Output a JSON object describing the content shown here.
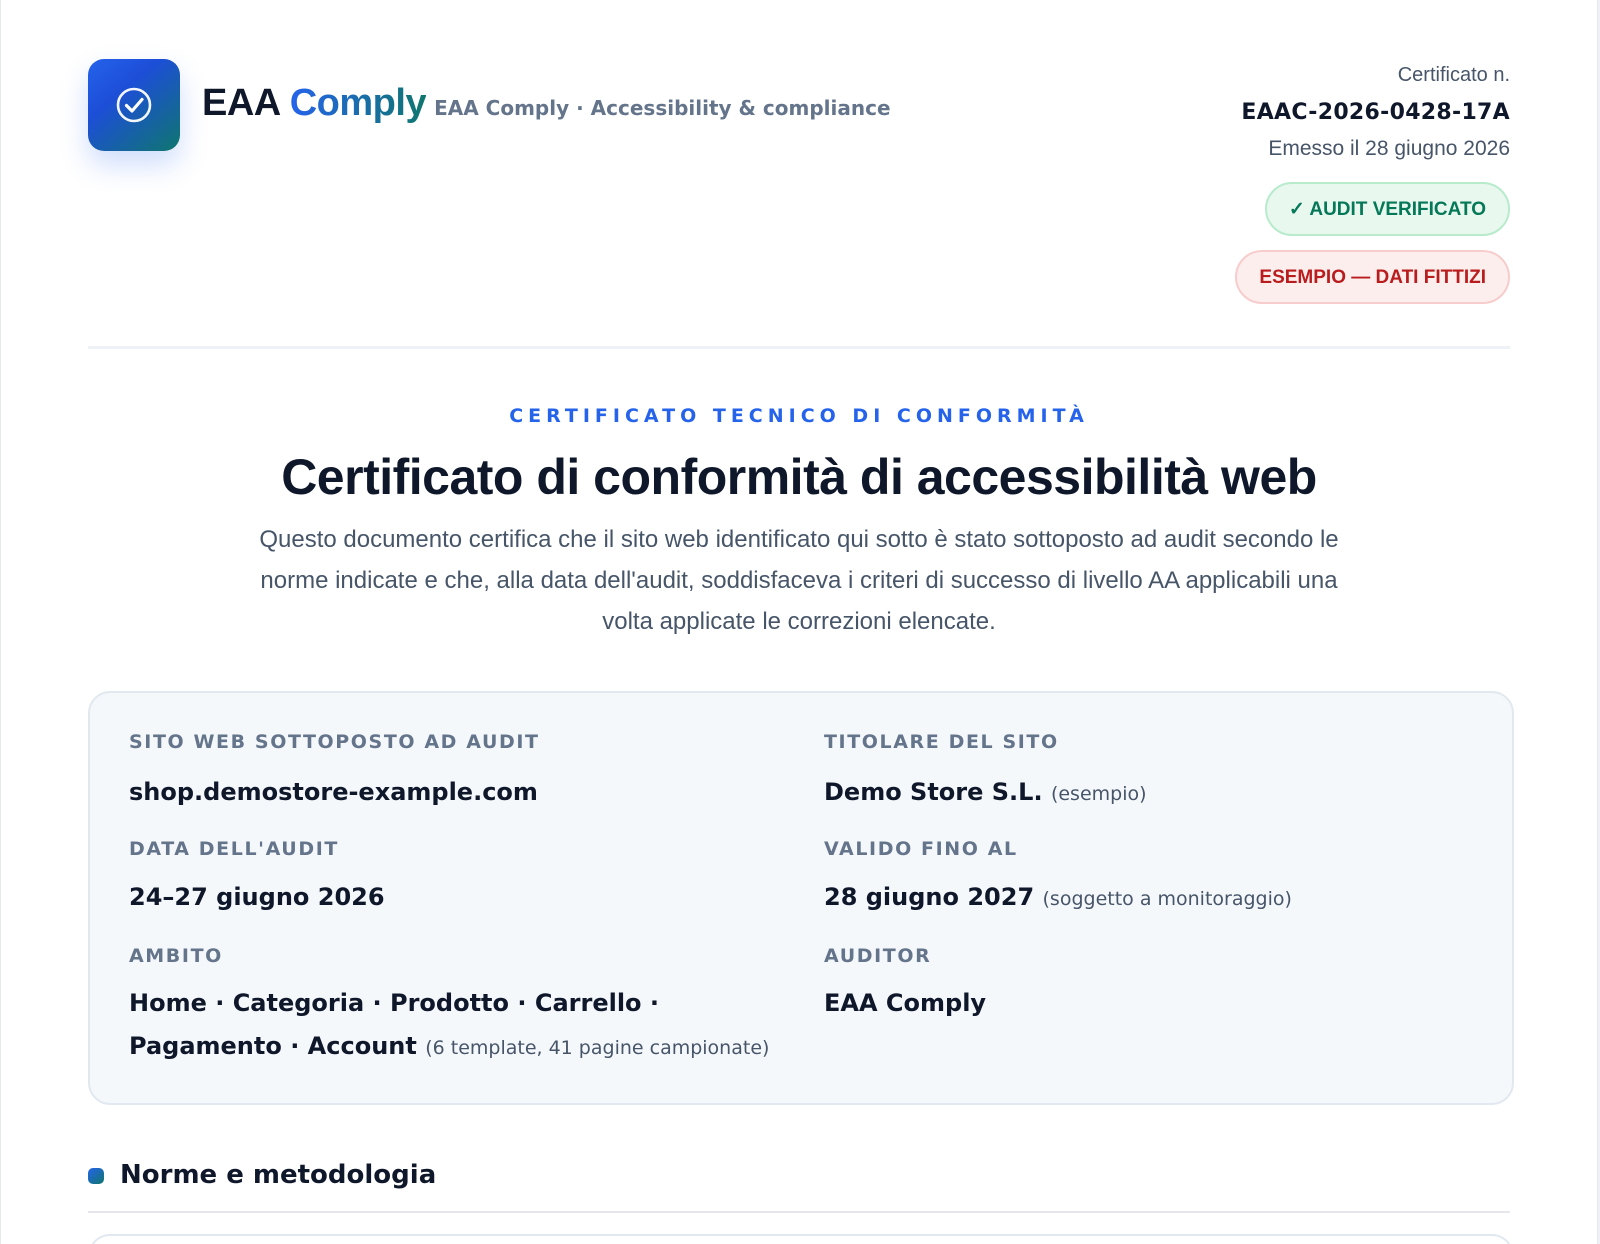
{
  "header": {
    "brand_primary": "EAA",
    "brand_secondary": "Comply",
    "tagline": "EAA Comply · Accessibility & compliance",
    "logo_icon": "check-circle-icon",
    "certificate_label": "Certificato n.",
    "certificate_number": "EAAC-2026-0428-17A",
    "issued": "Emesso il 28 giugno 2026",
    "badge_verified": "✓ AUDIT VERIFICATO",
    "badge_example": "ESEMPIO — DATI FITTIZI"
  },
  "hero": {
    "eyebrow": "CERTIFICATO TECNICO DI CONFORMITÀ",
    "title": "Certificato di conformità di accessibilità web",
    "description": "Questo documento certifica che il sito web identificato qui sotto è stato sottoposto ad audit secondo le norme indicate e che, alla data dell'audit, soddisfaceva i criteri di successo di livello AA applicabili una volta applicate le correzioni elencate."
  },
  "details": {
    "website_label": "SITO WEB SOTTOPOSTO AD AUDIT",
    "website_value": "shop.demostore-example.com",
    "owner_label": "TITOLARE DEL SITO",
    "owner_value": "Demo Store S.L.",
    "owner_note": "(esempio)",
    "audit_date_label": "DATA DELL'AUDIT",
    "audit_date_value": "24–27 giugno 2026",
    "valid_until_label": "VALIDO FINO AL",
    "valid_until_value": "28 giugno 2027",
    "valid_until_note": "(soggetto a monitoraggio)",
    "scope_label": "AMBITO",
    "scope_value": "Home · Categoria · Prodotto · Carrello · Pagamento · Account",
    "scope_note": "(6 template, 41 pagine campionate)",
    "auditor_label": "AUDITOR",
    "auditor_value": "EAA Comply"
  },
  "section": {
    "title": "Norme e metodologia"
  },
  "colors": {
    "accent": "#2563eb",
    "accent_teal": "#0f766e",
    "success": "#047857",
    "danger": "#b91c1c"
  }
}
